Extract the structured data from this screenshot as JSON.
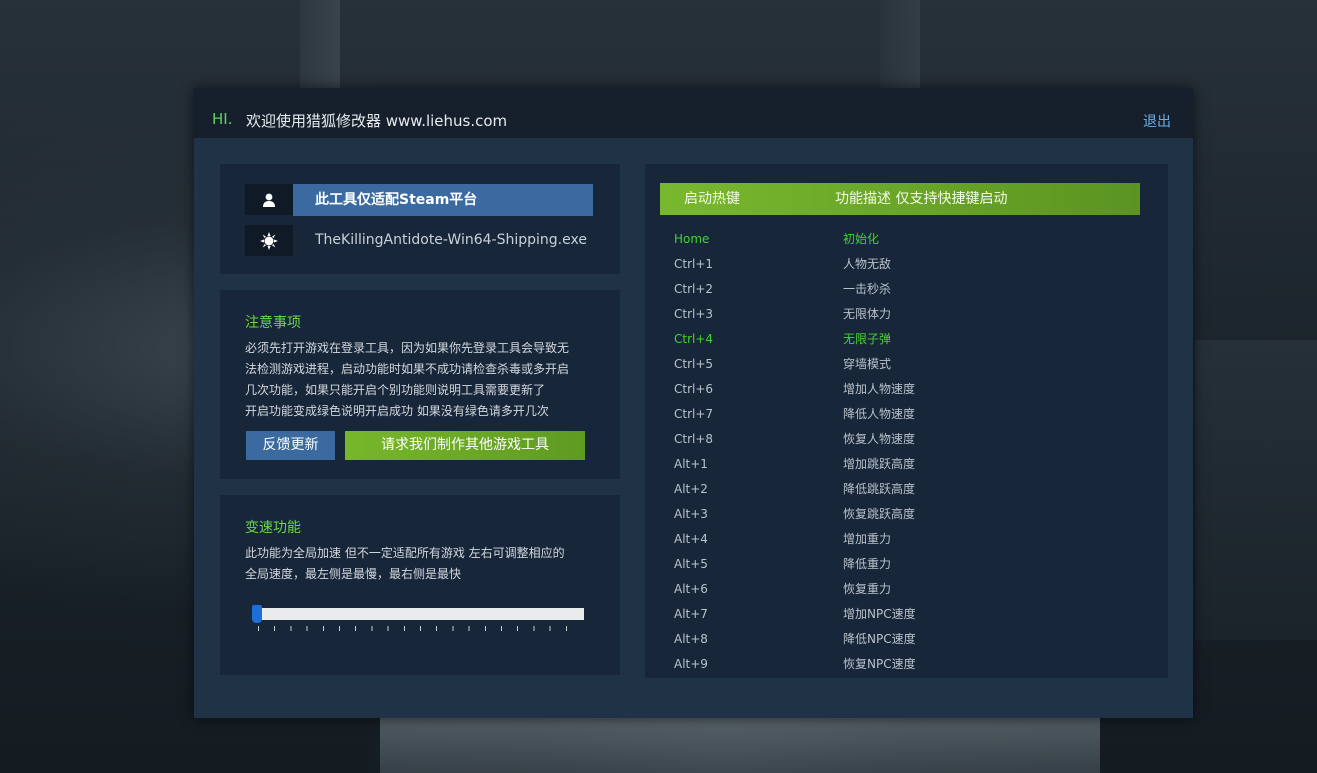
{
  "header": {
    "greeting": "HI.",
    "title": "欢迎使用猎狐修改器 www.liehus.com",
    "logout_label": "退出"
  },
  "info": {
    "platform_notice": "此工具仅适配Steam平台",
    "process_name": "TheKillingAntidote-Win64-Shipping.exe",
    "user_icon": "user-icon",
    "process_icon": "gear-icon"
  },
  "notice": {
    "title": "注意事项",
    "lines": [
      "必须先打开游戏在登录工具，因为如果你先登录工具会导致无",
      "法检测游戏进程，启动功能时如果不成功请检查杀毒或多开启",
      "几次功能，如果只能开启个别功能则说明工具需要更新了",
      "开启功能变成绿色说明开启成功 如果没有绿色请多开几次"
    ],
    "feedback_label": "反馈更新",
    "request_label": "请求我们制作其他游戏工具"
  },
  "speed": {
    "title": "变速功能",
    "lines": [
      "此功能为全局加速 但不一定适配所有游戏 左右可调整相应的",
      "全局速度，最左侧是最慢，最右侧是最快"
    ],
    "slider_value": 0
  },
  "hotkeys": {
    "header_key": "启动热键",
    "header_desc": "功能描述 仅支持快捷键启动",
    "rows": [
      {
        "key": "Home",
        "desc": "初始化",
        "active": true
      },
      {
        "key": "Ctrl+1",
        "desc": "人物无敌",
        "active": false
      },
      {
        "key": "Ctrl+2",
        "desc": "一击秒杀",
        "active": false
      },
      {
        "key": "Ctrl+3",
        "desc": "无限体力",
        "active": false
      },
      {
        "key": "Ctrl+4",
        "desc": "无限子弹",
        "active": true
      },
      {
        "key": "Ctrl+5",
        "desc": "穿墙模式",
        "active": false
      },
      {
        "key": "Ctrl+6",
        "desc": "增加人物速度",
        "active": false
      },
      {
        "key": "Ctrl+7",
        "desc": "降低人物速度",
        "active": false
      },
      {
        "key": "Ctrl+8",
        "desc": "恢复人物速度",
        "active": false
      },
      {
        "key": "Alt+1",
        "desc": "增加跳跃高度",
        "active": false
      },
      {
        "key": "Alt+2",
        "desc": "降低跳跃高度",
        "active": false
      },
      {
        "key": "Alt+3",
        "desc": "恢复跳跃高度",
        "active": false
      },
      {
        "key": "Alt+4",
        "desc": "增加重力",
        "active": false
      },
      {
        "key": "Alt+5",
        "desc": "降低重力",
        "active": false
      },
      {
        "key": "Alt+6",
        "desc": "恢复重力",
        "active": false
      },
      {
        "key": "Alt+7",
        "desc": "增加NPC速度",
        "active": false
      },
      {
        "key": "Alt+8",
        "desc": "降低NPC速度",
        "active": false
      },
      {
        "key": "Alt+9",
        "desc": "恢复NPC速度",
        "active": false
      }
    ]
  },
  "colors": {
    "accent_green": "#43d332",
    "accent_blue": "#3a6aa0",
    "window_bg": "#1b2838"
  }
}
